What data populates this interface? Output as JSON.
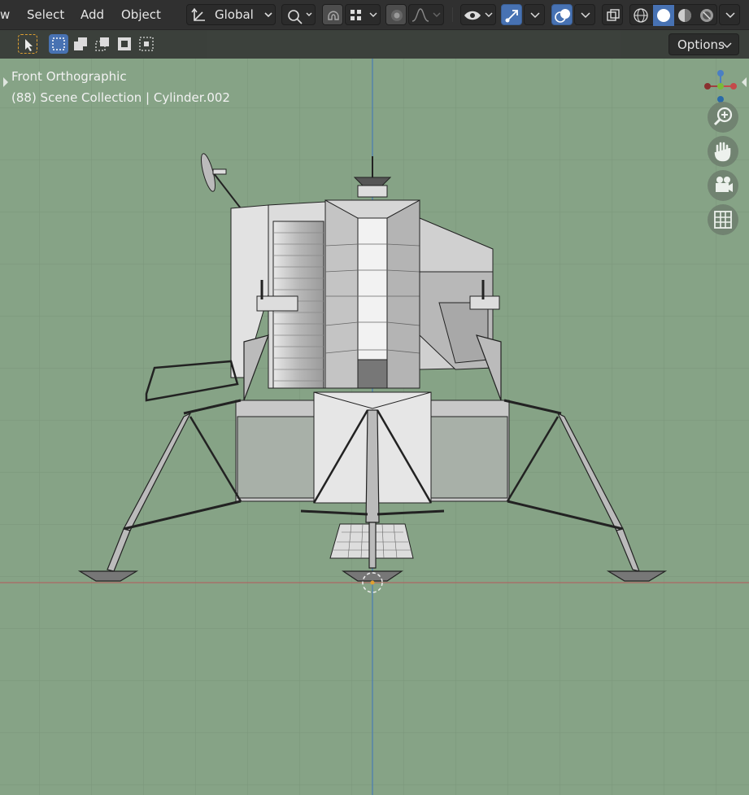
{
  "header": {
    "menu": [
      {
        "label": "w"
      },
      {
        "label": "Select"
      },
      {
        "label": "Add"
      },
      {
        "label": "Object"
      }
    ],
    "transform_orientation": "Global"
  },
  "toolbar2": {
    "options_label": "Options"
  },
  "viewport": {
    "view_name": "Front Orthographic",
    "scene_info": "(88) Scene Collection | Cylinder.002"
  },
  "colors": {
    "header_bg": "#303030",
    "viewport_bg": "#86a386",
    "accent_blue": "#4772b3",
    "x_axis": "#c44a4a",
    "z_axis": "#4a7fc4"
  },
  "icons": {
    "transform": "transform-orientation-icon",
    "pivot": "pivot-point-icon",
    "snap": "snap-magnet-icon",
    "proportional": "proportional-edit-icon",
    "visibility": "eye-icon",
    "gizmo": "gizmo-icon",
    "overlay": "overlay-icon",
    "xray": "xray-icon"
  }
}
